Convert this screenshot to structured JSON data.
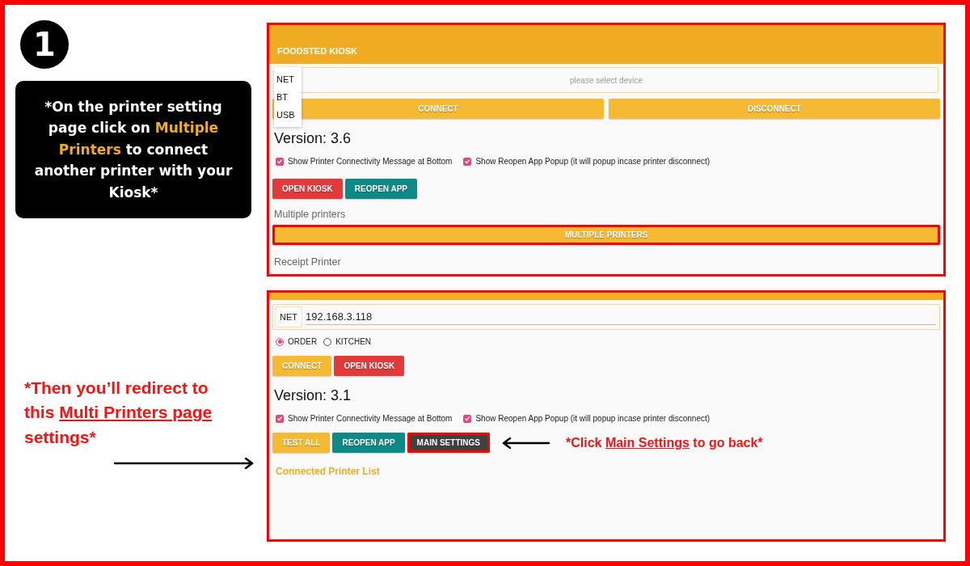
{
  "step_badge": "1",
  "intro_note": [
    {
      "text": "*On the printer setting page click on ",
      "kind": "plain"
    },
    {
      "text": "Multiple Printers",
      "kind": "highlight"
    },
    {
      "text": " to connect another printer with your Kiosk*",
      "kind": "plain"
    }
  ],
  "redirect_note": [
    {
      "text": "*Then you’ll redirect to this ",
      "kind": "plain"
    },
    {
      "text": "Multi Printers page",
      "kind": "underline"
    },
    {
      "text": " settings*",
      "kind": "plain"
    }
  ],
  "screen_1": {
    "title": "FOODSTED KIOSK",
    "device_menu": [
      {
        "label": "NET"
      },
      {
        "label": "BT"
      },
      {
        "label": "USB"
      }
    ],
    "device_field": {
      "placeholder": "please select device"
    },
    "buttons": [
      {
        "label": "CONNECT",
        "kind": "primary"
      },
      {
        "label": "DISCONNECT",
        "kind": "primary"
      }
    ],
    "version": "Version: 3.6",
    "options": [
      {
        "label": "Show Printer Connectivity Message at Bottom",
        "checked": true
      },
      {
        "label": "Show Reopen App Popup (it will popup incase printer disconnect)",
        "checked": true
      }
    ],
    "action_buttons": [
      {
        "label": "OPEN KIOSK",
        "kind": "danger",
        "highlighted": false
      },
      {
        "label": "REOPEN APP",
        "kind": "accent",
        "highlighted": false
      }
    ],
    "multiple_printers_label": "Multiple printers",
    "multiple_printers_button": {
      "label": "MULTIPLE PRINTERS",
      "highlighted": true
    },
    "receipt_printer_label": "Receipt Printer"
  },
  "screen_2": {
    "connection_type": "NET",
    "ip_address": "192.168.3.118",
    "printer_roles": [
      {
        "label": "ORDER",
        "selected": true
      },
      {
        "label": "KITCHEN",
        "selected": false
      }
    ],
    "buttons": [
      {
        "label": "CONNECT",
        "kind": "primary",
        "highlighted": false
      },
      {
        "label": "OPEN KIOSK",
        "kind": "danger",
        "highlighted": false
      }
    ],
    "version": "Version: 3.1",
    "options": [
      {
        "label": "Show Printer Connectivity Message at Bottom",
        "checked": true
      },
      {
        "label": "Show Reopen App Popup (it will popup incase printer disconnect)",
        "checked": true
      }
    ],
    "action_buttons": [
      {
        "label": "TEST ALL",
        "kind": "primary",
        "highlighted": false
      },
      {
        "label": "REOPEN APP",
        "kind": "accent",
        "highlighted": false
      },
      {
        "label": "MAIN SETTINGS",
        "kind": "dark",
        "highlighted": true
      }
    ],
    "back_note": [
      {
        "text": "*Click ",
        "kind": "plain"
      },
      {
        "text": "Main Settings",
        "kind": "underline"
      },
      {
        "text": " to go back*",
        "kind": "plain"
      }
    ],
    "connected_printer_list": "Connected Printer List"
  }
}
